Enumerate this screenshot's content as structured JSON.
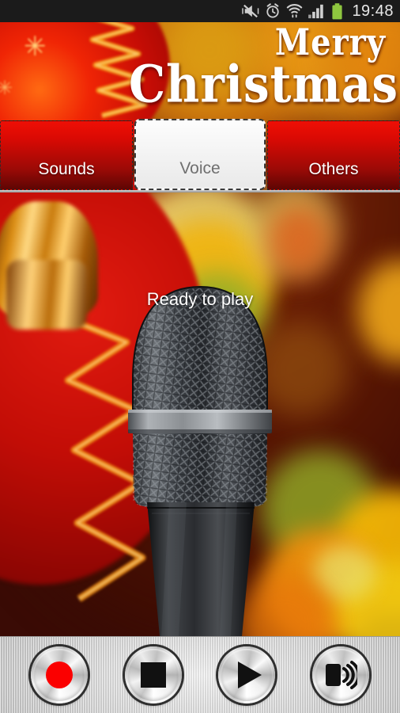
{
  "statusbar": {
    "time": "19:48",
    "icons": [
      {
        "name": "mute-vibrate-icon",
        "label": "silent mode"
      },
      {
        "name": "alarm-clock-icon",
        "label": "alarm set"
      },
      {
        "name": "wifi-icon",
        "label": "wifi connected"
      },
      {
        "name": "signal-bars-icon",
        "label": "cellular signal"
      },
      {
        "name": "battery-icon",
        "label": "battery full"
      }
    ],
    "colors": {
      "background": "#1b1b1b",
      "icon": "#cfcfcf",
      "battery": "#8ec63f",
      "text": "#e8e8e8"
    }
  },
  "header": {
    "title_line1": "Merry",
    "title_line2": "Christmas"
  },
  "tabs": {
    "items": [
      {
        "label": "Sounds",
        "active": false
      },
      {
        "label": "Voice",
        "active": true
      },
      {
        "label": "Others",
        "active": false
      }
    ],
    "colors": {
      "inactive_top": "#ef0f05",
      "inactive_bottom": "#5d0604",
      "inactive_text": "#ffffff",
      "active_bg": "#f2f2f2",
      "active_text": "#6f6f6f",
      "active_border": "#3a3a3a"
    }
  },
  "main": {
    "status_text": "Ready to play",
    "image": "microphone"
  },
  "controls": {
    "buttons": [
      {
        "name": "record-button",
        "icon": "record-icon",
        "label": "Record"
      },
      {
        "name": "stop-button",
        "icon": "stop-icon",
        "label": "Stop"
      },
      {
        "name": "play-button",
        "icon": "play-icon",
        "label": "Play"
      },
      {
        "name": "set-ringtone-button",
        "icon": "speaker-waves-icon",
        "label": "Set as ringtone"
      }
    ],
    "colors": {
      "record": "#fb0000",
      "glyph": "#111111",
      "bar": "#d9d9d9"
    }
  }
}
